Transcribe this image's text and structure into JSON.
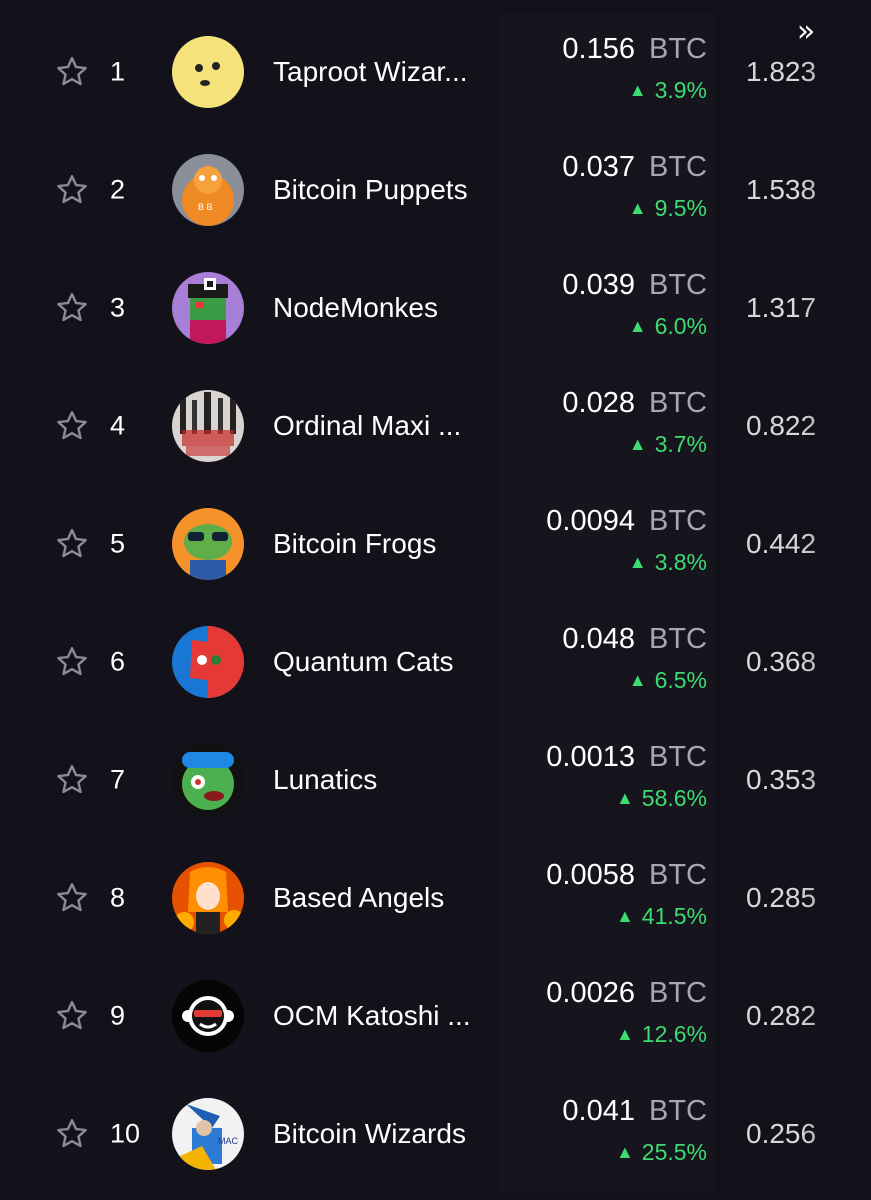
{
  "header": {
    "scroll_right_icon": "double-chevron-right-icon",
    "scroll_right_glyph": "»"
  },
  "unit": "BTC",
  "colors": {
    "background": "#13111a",
    "positive": "#3ddc71",
    "unit_text": "#a9a6b3"
  },
  "rows": [
    {
      "rank": "1",
      "name": "Taproot Wizar...",
      "price": "0.156",
      "change": "3.9%",
      "volume": "1.823",
      "avatar": "wizard-face"
    },
    {
      "rank": "2",
      "name": "Bitcoin Puppets",
      "price": "0.037",
      "change": "9.5%",
      "volume": "1.538",
      "avatar": "orange-monkey"
    },
    {
      "rank": "3",
      "name": "NodeMonkes",
      "price": "0.039",
      "change": "6.0%",
      "volume": "1.317",
      "avatar": "pixel-monkey"
    },
    {
      "rank": "4",
      "name": "Ordinal Maxi ...",
      "price": "0.028",
      "change": "3.7%",
      "volume": "0.822",
      "avatar": "ordinal-maxi-biz"
    },
    {
      "rank": "5",
      "name": "Bitcoin Frogs",
      "price": "0.0094",
      "change": "3.8%",
      "volume": "0.442",
      "avatar": "frog"
    },
    {
      "rank": "6",
      "name": "Quantum Cats",
      "price": "0.048",
      "change": "6.5%",
      "volume": "0.368",
      "avatar": "quantum-cat"
    },
    {
      "rank": "7",
      "name": "Lunatics",
      "price": "0.0013",
      "change": "58.6%",
      "volume": "0.353",
      "avatar": "green-lunatic"
    },
    {
      "rank": "8",
      "name": "Based Angels",
      "price": "0.0058",
      "change": "41.5%",
      "volume": "0.285",
      "avatar": "angel-girl"
    },
    {
      "rank": "9",
      "name": "OCM Katoshi ...",
      "price": "0.0026",
      "change": "12.6%",
      "volume": "0.282",
      "avatar": "katoshi-monkey"
    },
    {
      "rank": "10",
      "name": "Bitcoin Wizards",
      "price": "0.041",
      "change": "25.5%",
      "volume": "0.256",
      "avatar": "blue-wizard"
    }
  ]
}
